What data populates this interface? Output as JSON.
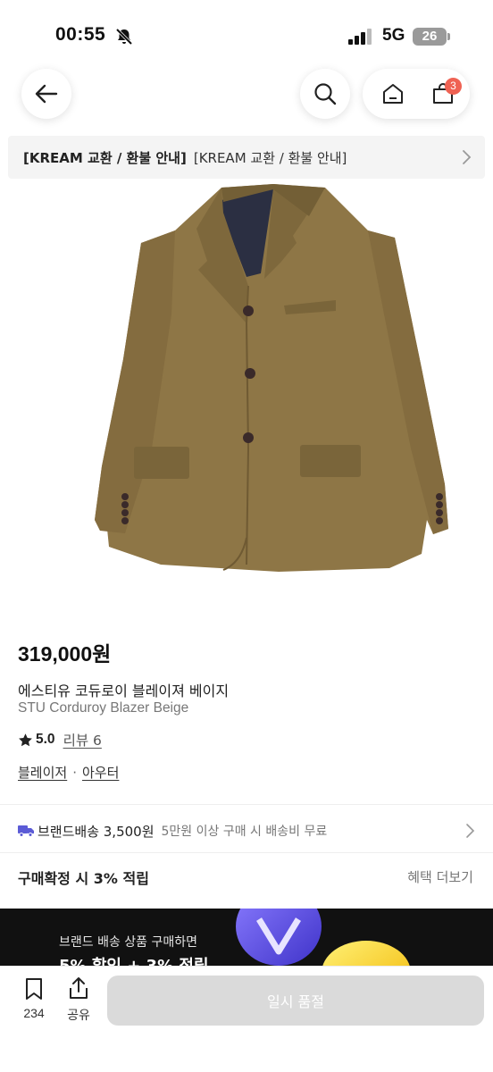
{
  "status_bar": {
    "time": "00:55",
    "network": "5G",
    "battery": "26"
  },
  "header": {
    "cart_count": "3"
  },
  "notice": {
    "bold_text": "[KREAM 교환 / 환불 안내]",
    "text": "[KREAM 교환 / 환불 안내]"
  },
  "product": {
    "price": "319,000",
    "price_unit": "원",
    "name_ko": "에스티유 코듀로이 블레이져 베이지",
    "name_en": "STU Corduroy Blazer Beige",
    "rating": "5.0",
    "review_label": "리뷰 6",
    "categories": [
      "블레이저",
      "아우터"
    ],
    "category_separator": "·",
    "image_colors": {
      "fabric": "#8e7646",
      "fabric_dark": "#6f5a33",
      "lining": "#2b2f42",
      "button": "#3a2a2a"
    }
  },
  "delivery": {
    "label": "브랜드배송 3,500원",
    "note": "5만원 이상 구매 시 배송비 무료",
    "icon_color": "#5b5bd6"
  },
  "points": {
    "label": "구매확정 시 3% 적립",
    "more": "혜택 더보기"
  },
  "promo": {
    "line1": "브랜드 배송 상품 구매하면",
    "line2": "5% 할인 + 3% 적립"
  },
  "bottom_bar": {
    "bookmark_count": "234",
    "share_label": "공유",
    "soldout_label": "일시 품절"
  },
  "colors": {
    "badge": "#ef6253",
    "soldout_bg": "#dadada",
    "promo_bg": "#111111",
    "notice_bg": "#f4f4f4"
  }
}
